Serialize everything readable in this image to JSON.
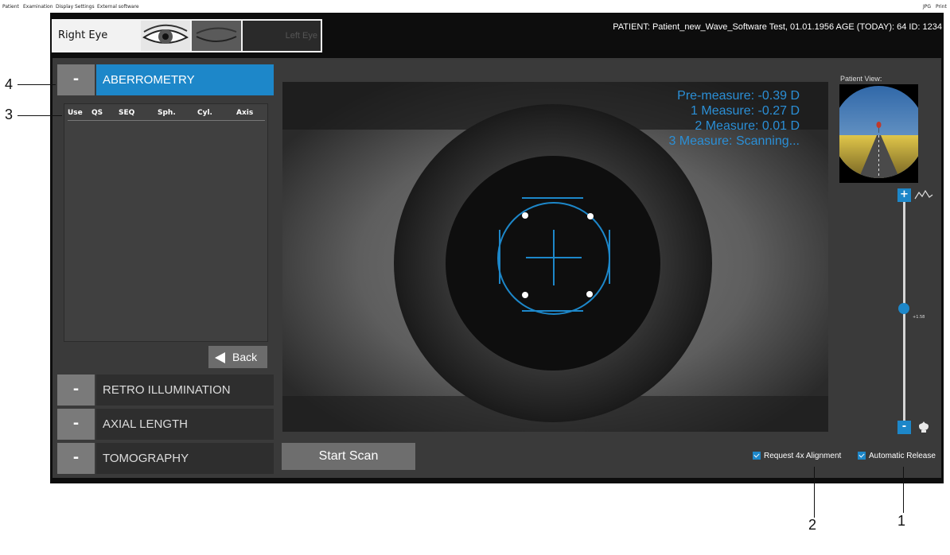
{
  "menu": {
    "items": [
      "Patient",
      "Examination",
      "Display",
      "Settings",
      "External software"
    ],
    "right_items": [
      "JPG",
      "Print"
    ]
  },
  "eye_selector": {
    "right_label": "Right Eye",
    "left_label": "Left Eye"
  },
  "patient_info": "PATIENT: Patient_new_Wave_Software Test, 01.01.1956   AGE (TODAY): 64   ID: 1234",
  "panels": {
    "aberrometry": {
      "button": "-",
      "title": "ABERROMETRY"
    },
    "retro": {
      "button": "-",
      "title": "RETRO ILLUMINATION"
    },
    "axial": {
      "button": "-",
      "title": "AXIAL LENGTH"
    },
    "tomography": {
      "button": "-",
      "title": "TOMOGRAPHY"
    }
  },
  "table": {
    "headers": [
      "Use",
      "QS",
      "SEQ",
      "Sph.",
      "Cyl.",
      "Axis"
    ]
  },
  "back_label": "Back",
  "measurements": {
    "pre": "Pre-measure: -0.39 D",
    "m1": "1 Measure: -0.27 D",
    "m2": "2 Measure: 0.01 D",
    "m3": "3 Measure: Scanning..."
  },
  "start_scan": "Start Scan",
  "checkboxes": {
    "align": "Request 4x Alignment",
    "release": "Automatic Release"
  },
  "patient_view_label": "Patient View:",
  "zoom": {
    "plus": "+",
    "minus": "-",
    "value": "+1.58",
    "level": 0.52
  },
  "callouts": {
    "c1": "1",
    "c2": "2",
    "c3": "3",
    "c4": "4"
  },
  "colors": {
    "accent": "#1d87c9",
    "measure_text": "#2b8fd6"
  },
  "icons": [
    "eye-open-icon",
    "eye-closed-icon",
    "mountain-icon",
    "flower-icon",
    "arrow-left-icon",
    "checkbox-checked-icon"
  ]
}
